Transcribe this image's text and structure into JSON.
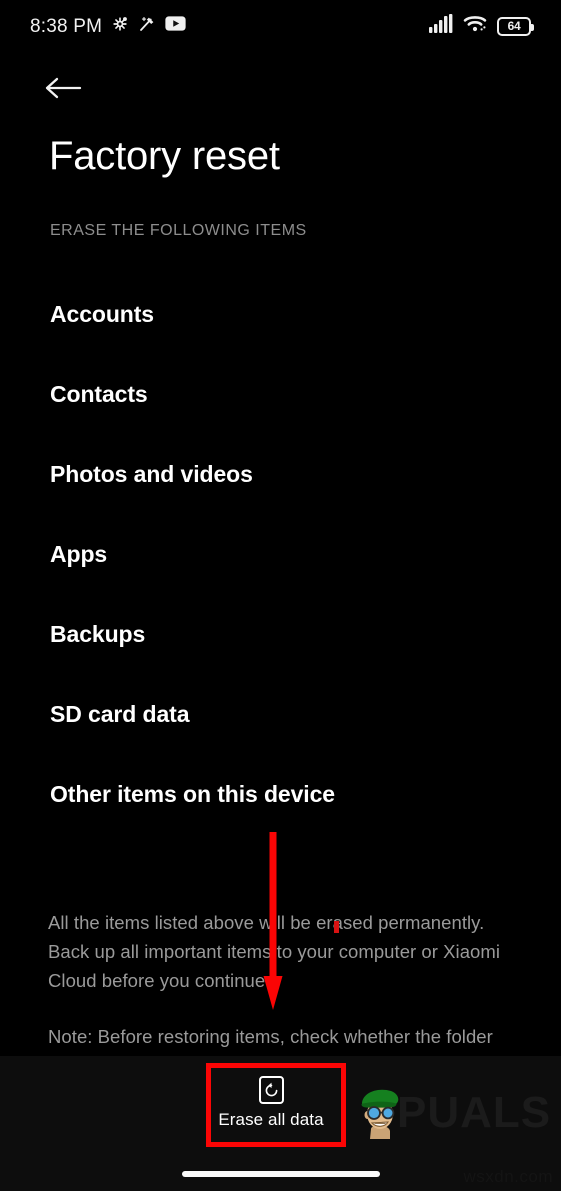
{
  "status_bar": {
    "time": "8:38 PM",
    "left_icons": [
      "bluetooth-share-icon",
      "magic-wand-icon",
      "youtube-icon"
    ],
    "right_icons": [
      "cellular-signal-icon",
      "wifi-icon"
    ],
    "battery_percent": "64"
  },
  "header": {
    "back_icon": "arrow-left-icon",
    "title": "Factory reset",
    "section_label": "ERASE THE FOLLOWING ITEMS"
  },
  "erase_items": [
    {
      "label": "Accounts"
    },
    {
      "label": "Contacts"
    },
    {
      "label": "Photos and videos"
    },
    {
      "label": "Apps"
    },
    {
      "label": "Backups"
    },
    {
      "label": "SD card data"
    },
    {
      "label": "Other items on this device"
    }
  ],
  "notice": {
    "paragraph_1": "All the items listed above will be erased permanently. Back up all important items to your computer or Xiaomi Cloud before you continue.",
    "paragraph_2": "Note: Before restoring items, check whether the folder \"MIUI-Backup-AllBackup\" exists on your mobile device. If it doesn't exist, restoring items"
  },
  "bottom_bar": {
    "erase_button_label": "Erase all data",
    "erase_button_icon": "reset-device-icon",
    "home_indicator": "home-indicator"
  },
  "annotations": {
    "arrow_color": "#fb0505",
    "box_color": "#fb0505",
    "arrow_target": "Erase all data"
  },
  "watermarks": {
    "brand_text": "PUALS",
    "site_text": "wsxdn.com"
  },
  "colors": {
    "background": "#000000",
    "bottom_bar": "#0d0d0d",
    "primary_text": "#ffffff",
    "secondary_text": "#9a9a9a",
    "label_text": "#8d8d8d",
    "accent_red": "#fb0505"
  }
}
